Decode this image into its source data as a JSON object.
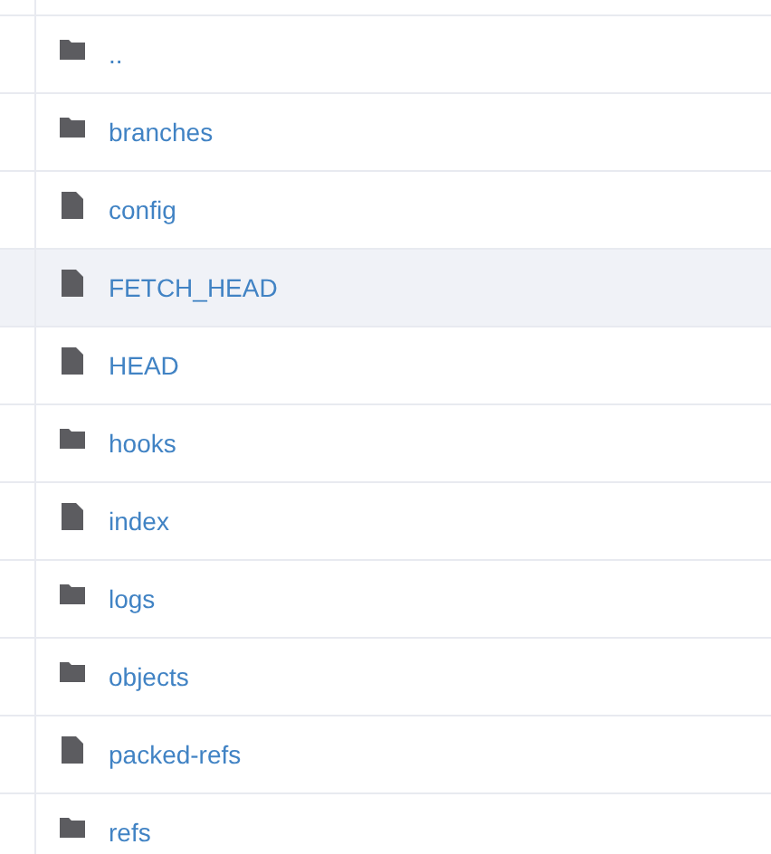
{
  "files": [
    {
      "kind": "folder",
      "name": "..",
      "selected": false
    },
    {
      "kind": "folder",
      "name": "branches",
      "selected": false
    },
    {
      "kind": "file",
      "name": "config",
      "selected": false
    },
    {
      "kind": "file",
      "name": "FETCH_HEAD",
      "selected": true
    },
    {
      "kind": "file",
      "name": "HEAD",
      "selected": false
    },
    {
      "kind": "folder",
      "name": "hooks",
      "selected": false
    },
    {
      "kind": "file",
      "name": "index",
      "selected": false
    },
    {
      "kind": "folder",
      "name": "logs",
      "selected": false
    },
    {
      "kind": "folder",
      "name": "objects",
      "selected": false
    },
    {
      "kind": "file",
      "name": "packed-refs",
      "selected": false
    },
    {
      "kind": "folder",
      "name": "refs",
      "selected": false
    }
  ]
}
